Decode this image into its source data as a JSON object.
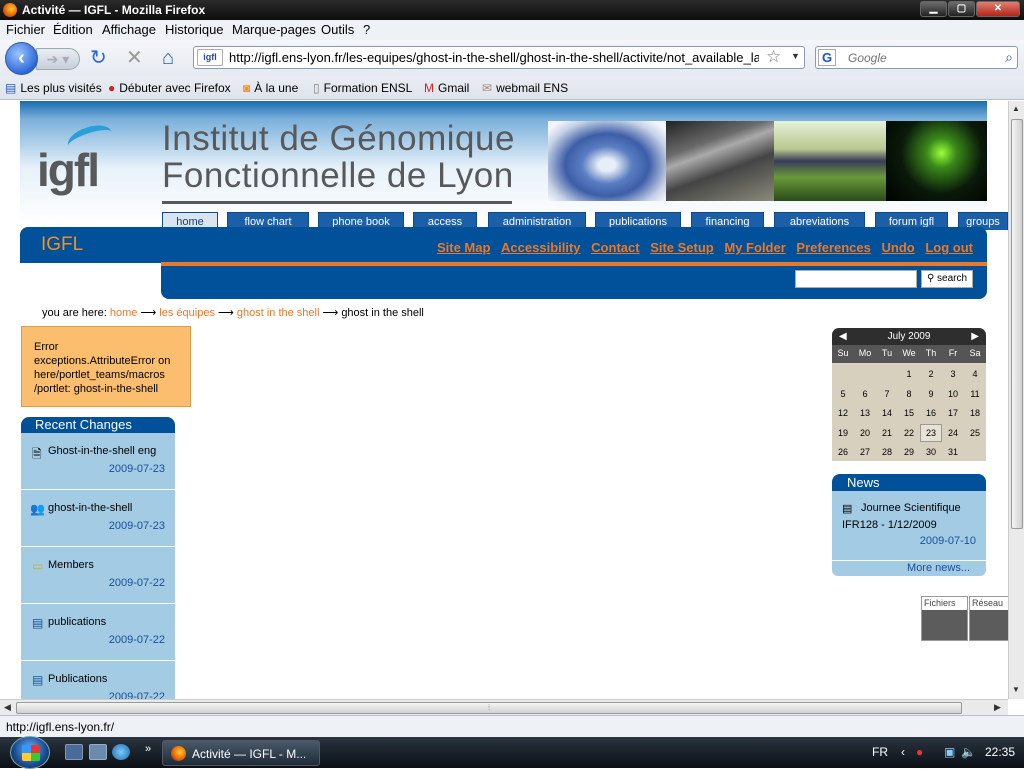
{
  "window": {
    "title": "Activité — IGFL - Mozilla Firefox"
  },
  "menu": [
    "Fichier",
    "Édition",
    "Affichage",
    "Historique",
    "Marque-pages",
    "Outils",
    "?"
  ],
  "nav": {
    "url": "http://igfl.ens-lyon.fr/les-equipes/ghost-in-the-shell/ghost-in-the-shell/activite/not_available_lang/v",
    "site_badge": "igfl",
    "search_placeholder": "Google"
  },
  "bookmarks": [
    "Les plus visités",
    "Débuter avec Firefox",
    "À la une",
    "Formation ENSL",
    "Gmail",
    "webmail ENS"
  ],
  "site": {
    "logo": "igfl",
    "title_line1": "Institut de Génomique",
    "title_line2": "Fonctionnelle de Lyon",
    "tabs": [
      "home",
      "flow chart",
      "phone book",
      "access",
      "administration",
      "publications",
      "financing",
      "abreviations",
      "forum igfl",
      "groups"
    ],
    "brand": "IGFL",
    "site_links": [
      "Site Map",
      "Accessibility",
      "Contact",
      "Site Setup",
      "My Folder",
      "Preferences",
      "Undo",
      "Log out"
    ],
    "search_button": "search",
    "breadcrumb_prefix": "you are here:",
    "breadcrumb": [
      "home",
      "les équipes",
      "ghost in the shell",
      "ghost in the shell"
    ]
  },
  "error": {
    "line1": "Error",
    "line2": "exceptions.AttributeError on",
    "line3": "here/portlet_teams/macros",
    "line4": "/portlet: ghost-in-the-shell"
  },
  "recent": {
    "title": "Recent Changes",
    "items": [
      {
        "title": "Ghost-in-the-shell eng",
        "date": "2009-07-23",
        "icon": "document-icon"
      },
      {
        "title": "ghost-in-the-shell",
        "date": "2009-07-23",
        "icon": "group-icon"
      },
      {
        "title": "Members",
        "date": "2009-07-22",
        "icon": "folder-icon"
      },
      {
        "title": "publications",
        "date": "2009-07-22",
        "icon": "page-icon"
      },
      {
        "title": "Publications",
        "date": "2009-07-22",
        "icon": "page-icon"
      }
    ]
  },
  "calendar": {
    "month": "July 2009",
    "weekdays": [
      "Su",
      "Mo",
      "Tu",
      "We",
      "Th",
      "Fr",
      "Sa"
    ],
    "weeks": [
      [
        "",
        "",
        "",
        "1",
        "2",
        "3",
        "4"
      ],
      [
        "5",
        "6",
        "7",
        "8",
        "9",
        "10",
        "11"
      ],
      [
        "12",
        "13",
        "14",
        "15",
        "16",
        "17",
        "18"
      ],
      [
        "19",
        "20",
        "21",
        "22",
        "23",
        "24",
        "25"
      ],
      [
        "26",
        "27",
        "28",
        "29",
        "30",
        "31",
        ""
      ]
    ],
    "today": "23"
  },
  "news": {
    "title": "News",
    "item": "Journee Scientifique IFR128 - 1/12/2009",
    "date": "2009-07-10",
    "more": "More news..."
  },
  "widgets": [
    "Fichiers",
    "Réseau"
  ],
  "status": "http://igfl.ens-lyon.fr/",
  "taskbar": {
    "task": "Activité — IGFL - M...",
    "lang": "FR",
    "clock": "22:35"
  },
  "colors": {
    "brand_blue": "#00509a",
    "accent_orange": "#e8792a",
    "portlet_blue": "#a3cbe4"
  }
}
